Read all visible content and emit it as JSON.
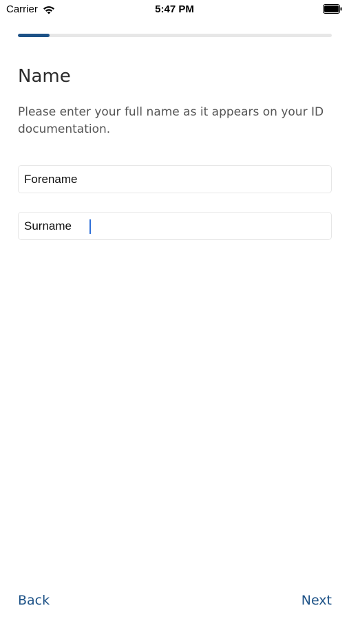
{
  "status_bar": {
    "carrier": "Carrier",
    "time": "5:47 PM",
    "wifi_icon": "wifi-icon",
    "battery_icon": "battery-full-icon"
  },
  "progress": {
    "fraction": 0.1,
    "color": "#1d5287",
    "track_color": "#e7e7e7"
  },
  "page": {
    "title": "Name",
    "description": "Please enter your full name as it appears on your ID documentation."
  },
  "form": {
    "forename": {
      "placeholder": "Forename",
      "value": ""
    },
    "surname": {
      "placeholder": "Surname",
      "value": ""
    }
  },
  "nav": {
    "back_label": "Back",
    "next_label": "Next",
    "accent_color": "#1d5287"
  }
}
